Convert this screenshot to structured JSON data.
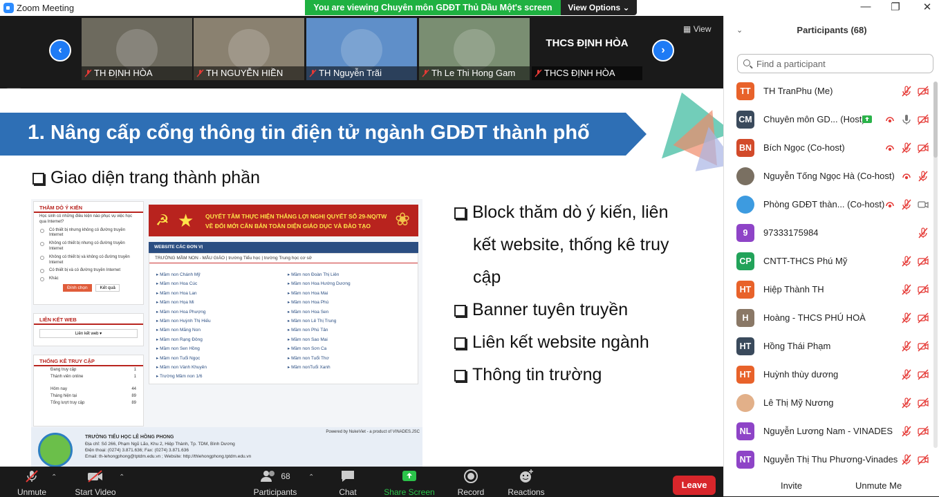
{
  "window": {
    "title": "Zoom Meeting"
  },
  "banner": {
    "viewing": "You are viewing Chuyên môn GDĐT Thủ Dầu Một's screen",
    "view_options": "View Options"
  },
  "thumbs": [
    {
      "name": "TH ĐỊNH HÒA",
      "color": "#6d6a5e"
    },
    {
      "name": "TH NGUYỄN HIỀN",
      "color": "#8a8170"
    },
    {
      "name": "TH Nguyễn Trãi",
      "color": "#5f8fc9"
    },
    {
      "name": "Th Le Thi Hong Gam",
      "color": "#7a8e72"
    },
    {
      "name": "THCS ĐỊNH HÒA",
      "label": "THCS ĐỊNH HÒA",
      "color": "#1a1a1a"
    }
  ],
  "view_label": "View",
  "slide": {
    "number": "1.",
    "title": "Nâng cấp cổng thông tin điện tử ngành GDĐT thành phố",
    "subtitle": "Giao diện trang thành phần",
    "bullets": [
      "Block thăm dò ý kiến, liên",
      "kết website, thống kê truy",
      "cập",
      "Banner tuyên truyền",
      "Liên kết website ngành",
      "Thông tin trường"
    ],
    "shot": {
      "poll_title": "THĂM DÒ Ý KIẾN",
      "poll_question": "Học sinh có những điều kiện nào phục vụ việc học qua Internet?",
      "poll_options": [
        "Có thiết bị nhưng không có đường truyền Internet",
        "Không có thiết bị nhưng có đường truyền Internet",
        "Không có thiết bị và không có đường truyền Internet",
        "Có thiết bị và có đường truyền Internet",
        "Khác"
      ],
      "vote": "Đính chọn",
      "result": "Kết quả",
      "links_title": "LIÊN KẾT WEB",
      "links_select": "Liên kết web ▾",
      "stats_title": "THỐNG KÊ TRUY CẬP",
      "stats": [
        [
          "Đang truy cập",
          "1"
        ],
        [
          "Thành viên online",
          "1"
        ],
        [
          "Hôm nay",
          "44"
        ],
        [
          "Tháng hiện tại",
          "89"
        ],
        [
          "Tổng lượt truy cập",
          "89"
        ]
      ],
      "banner_line1": "QUYẾT TÂM THỰC HIỆN THẮNG LỢI NGHỊ QUYẾT SỐ 29-NQ/TW",
      "banner_line2": "VỀ ĐỔI MỚI CĂN BẢN TOÀN DIỆN GIÁO DỤC VÀ ĐÀO TẠO",
      "units_title": "WEBSITE CÁC ĐƠN VỊ",
      "units_tabs": "TRƯỜNG MẦM NON - MẪU GIÁO | trường Tiểu học | trường Trung học cơ sở",
      "col1": [
        "Mầm non Chánh Mỹ",
        "Mầm non Hoa Cúc",
        "Mầm non Hoa Lan",
        "Mầm non Họa Mi",
        "Mầm non Hoa Phượng",
        "Mầm non Huỳnh Thị Hiếu",
        "Mầm non Măng Non",
        "Mầm non Rạng Đông",
        "Mầm non Sen Hồng",
        "Mầm non Tuổi Ngọc",
        "Mầm non Vành Khuyên",
        "Trường Mầm non 1/6"
      ],
      "col2": [
        "Mầm non Đoàn Thị Liên",
        "Mầm non Hoa Hướng Dương",
        "Mầm non Hoa Mai",
        "Mầm non Hoa Phú",
        "Mầm non Hoa Sen",
        "Mầm non Lê Thị Trung",
        "Mầm non Phú Tân",
        "Mầm non Sao Mai",
        "Mầm non Sơn Ca",
        "Mầm non Tuổi Thơ",
        "Mầm nonTuổi Xanh"
      ],
      "powered": "Powered by NukeViet - a product of VINADES.JSC",
      "school": "TRƯỜNG TIỂU HỌC LÊ HỒNG PHONG",
      "addr": "Địa chỉ: Số 266, Phạm Ngũ Lão, Khu 2, Hiệp Thành, Tp. TDM, Bình Dương",
      "phone": "Điện thoại: (0274) 3.871.636; Fax: (0274) 3.871.636",
      "email": "Email: th-lehongphong@tptdm.edu.vn ; Website: http://thlehongphong.tptdm.edu.vn"
    }
  },
  "toolbar": {
    "unmute": "Unmute",
    "start_video": "Start Video",
    "participants": "Participants",
    "participants_count": "68",
    "chat": "Chat",
    "share": "Share Screen",
    "record": "Record",
    "reactions": "Reactions",
    "leave": "Leave"
  },
  "panel": {
    "title": "Participants (68)",
    "search_placeholder": "Find a participant",
    "invite": "Invite",
    "unmute_me": "Unmute Me",
    "people": [
      {
        "initials": "TT",
        "name": "TH TranPhu (Me)",
        "color": "#e8622a"
      },
      {
        "initials": "CM",
        "name": "Chuyên môn GD...  (Host)",
        "color": "#3a4a5c"
      },
      {
        "initials": "BN",
        "name": "Bích Ngọc (Co-host)",
        "color": "#d24a2a"
      },
      {
        "initials": "",
        "name": "Nguyễn Tống Ngọc Hà (Co-host)",
        "color": "#7a7062"
      },
      {
        "initials": "",
        "name": "Phòng GDĐT thàn... (Co-host)",
        "color": "#3d9be0"
      },
      {
        "initials": "9",
        "name": "97333175984",
        "color": "#8e44c7"
      },
      {
        "initials": "CP",
        "name": "CNTT-THCS Phú Mỹ",
        "color": "#22a35a"
      },
      {
        "initials": "HT",
        "name": "Hiệp Thành TH",
        "color": "#e8622a"
      },
      {
        "initials": "H",
        "name": "Hoàng - THCS PHÚ HOÀ",
        "color": "#8a7866"
      },
      {
        "initials": "HT",
        "name": "Hồng Thái Phạm",
        "color": "#3a4a5c"
      },
      {
        "initials": "HT",
        "name": "Huỳnh thùy dương",
        "color": "#e8622a"
      },
      {
        "initials": "",
        "name": "Lê Thị Mỹ Nương",
        "color": "#e2b089"
      },
      {
        "initials": "NL",
        "name": "Nguyễn Lương Nam - VINADES",
        "color": "#8e44c7"
      },
      {
        "initials": "NT",
        "name": "Nguyễn Thị Thu Phương-Vinades",
        "color": "#8e44c7"
      }
    ]
  }
}
